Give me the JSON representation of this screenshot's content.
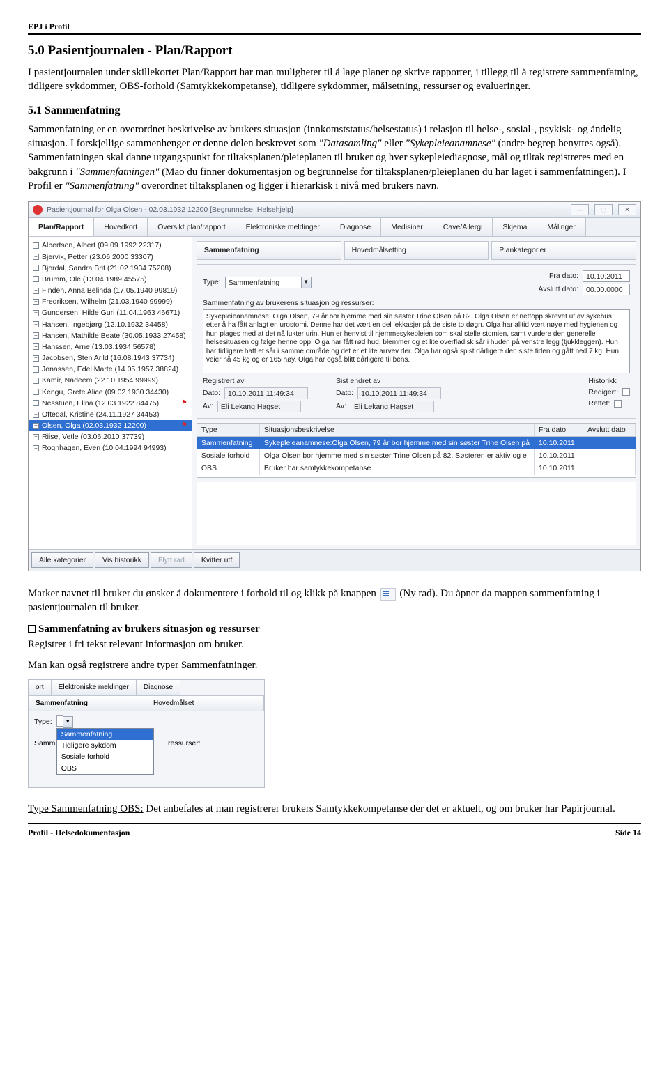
{
  "doc": {
    "header": "EPJ i Profil",
    "h2": "5.0 Pasientjournalen - Plan/Rapport",
    "p1": "I pasientjournalen under skillekortet Plan/Rapport har man muligheter til å lage planer og skrive rapporter, i tillegg til å registrere sammenfatning, tidligere sykdommer, OBS-forhold (Samtykkekompetanse), tidligere sykdommer, målsetning, ressurser og evalueringer.",
    "h3": "5.1 Sammenfatning",
    "p2a": "Sammenfatning er en overordnet beskrivelse av brukers situasjon (innkomststatus/helsestatus) i relasjon til helse-, sosial-, psykisk- og åndelig situasjon. I forskjellige sammenhenger er denne delen beskrevet som ",
    "p2b": "\"Datasamling\"",
    "p2c": " eller ",
    "p2d": "\"Sykepleieanamnese\"",
    "p2e": " (andre begrep benyttes også). Sammenfatningen skal danne utgangspunkt for tiltaksplanen/pleieplanen til bruker og hver sykepleiediagnose, mål og tiltak registreres med en bakgrunn i ",
    "p2f": "\"Sammenfatningen\"",
    "p2g": " (Mao du finner dokumentasjon og begrunnelse for tiltaksplanen/pleieplanen du har laget i sammenfatningen). I Profil er ",
    "p2h": "\"Sammenfatning\"",
    "p2i": " overordnet tiltaksplanen og ligger i hierarkisk i nivå med brukers navn.",
    "after1a": "Marker navnet til bruker du ønsker å dokumentere i forhold til og klikk på knappen ",
    "after1b": " (Ny rad). Du åpner da mappen sammenfatning i pasientjournalen til bruker.",
    "sub_heading": "Sammenfatning av brukers situasjon og ressurser",
    "sub_line": "Registrer i fri tekst relevant informasjon om bruker.",
    "after2": "Man kan også registrere andre typer Sammenfatninger.",
    "final_a": "Type Sammenfatning OBS:",
    "final_b": " Det anbefales at man registrerer brukers Samtykkekompetanse der det er aktuelt, og om bruker har Papirjournal.",
    "footer_left": "Profil - Helsedokumentasjon",
    "footer_right": "Side 14"
  },
  "app": {
    "title": "Pasientjournal for Olga Olsen - 02.03.1932 12200  [Begrunnelse: Helsehjelp]",
    "tabs": [
      "Plan/Rapport",
      "Hovedkort",
      "Oversikt plan/rapport",
      "Elektroniske meldinger",
      "Diagnose",
      "Medisiner",
      "Cave/Allergi",
      "Skjema",
      "Målinger"
    ],
    "patients": [
      {
        "t": "Albertson, Albert (09.09.1992 22317)"
      },
      {
        "t": "Bjervik, Petter (23.06.2000 33307)"
      },
      {
        "t": "Bjordal, Sandra Brit (21.02.1934 75208)"
      },
      {
        "t": "Brumm, Ole (13.04.1989 45575)"
      },
      {
        "t": "Finden, Anna Belinda (17.05.1940 99819)"
      },
      {
        "t": "Fredriksen, Wilhelm (21.03.1940 99999)"
      },
      {
        "t": "Gundersen, Hilde Guri (11.04.1963 46671)"
      },
      {
        "t": "Hansen, Ingebjørg (12.10.1932 34458)"
      },
      {
        "t": "Hansen, Mathilde Beate (30.05.1933 27458)"
      },
      {
        "t": "Hanssen, Arne (13.03.1934 56578)"
      },
      {
        "t": "Jacobsen, Sten Arild (16.08.1943 37734)"
      },
      {
        "t": "Jonassen, Edel Marte (14.05.1957 38824)"
      },
      {
        "t": "Kamir, Nadeem (22.10.1954 99999)"
      },
      {
        "t": "Kengu, Grete Alice (09.02.1930 34430)"
      },
      {
        "t": "Nesstuen, Elina (12.03.1922 84475)",
        "flag": true
      },
      {
        "t": "Oftedal, Kristine (24.11.1927 34453)"
      },
      {
        "t": "Olsen, Olga (02.03.1932 12200)",
        "selected": true,
        "flag": true
      },
      {
        "t": "Riise, Vetle (03.06.2010 37739)"
      },
      {
        "t": "Rognhagen, Even (10.04.1994 94993)"
      }
    ],
    "section_tabs": [
      "Sammenfatning",
      "Hovedmålsetting",
      "Plankategorier"
    ],
    "type_label": "Type:",
    "type_value": "Sammenfatning",
    "fra_label": "Fra dato:",
    "fra_value": "10.10.2011",
    "avslutt_label": "Avslutt dato:",
    "avslutt_value": "00.00.0000",
    "desc_label": "Sammenfatning av brukerens situasjon og ressurser:",
    "desc_text": "Sykepleieanamnese:\nOlga Olsen, 79 år bor hjemme med sin søster Trine Olsen på 82.\nOlga Olsen er nettopp skrevet ut av sykehus etter å ha fått anlagt en urostomi. Denne har det vært en del lekkasjer på de siste to døgn. Olga har alltid vært nøye med hygienen og hun plages med at det nå lukter urin. Hun er henvist til hjemmesykepleien som skal stelle stomien, samt vurdere den generelle helsesituasen og følge henne opp.\nOlga har fått rød hud, blemmer og et lite overfladisk sår i huden på venstre legg (tjukkleggen). Hun har tidligere hatt et sår i samme område og det er et lite arrvev der.\nOlga har også spist dårligere den siste tiden og gått ned 7 kg. Hun veier nå 45 kg og er 165 høy.\nOlga har også blitt dårligere til bens.",
    "reg_header": "Registrert av",
    "endret_header": "Sist endret av",
    "hist_header": "Historikk",
    "dato_label": "Dato:",
    "av_label": "Av:",
    "dato_value": "10.10.2011  11:49:34",
    "av_value": "Eli Lekang Hagset",
    "redigert_label": "Redigert:",
    "rettet_label": "Rettet:",
    "grid_heads": [
      "Type",
      "Situasjonsbeskrivelse",
      "Fra dato",
      "Avslutt dato"
    ],
    "grid_rows": [
      {
        "c1": "Sammenfatning",
        "c2": "Sykepleieanamnese:Olga Olsen, 79 år bor hjemme med sin søster Trine Olsen på",
        "c3": "10.10.2011",
        "c4": "",
        "sel": true
      },
      {
        "c1": "Sosiale forhold",
        "c2": "Olga Olsen bor hjemme med sin søster Trine Olsen på 82. Søsteren er aktiv og e",
        "c3": "10.10.2011",
        "c4": ""
      },
      {
        "c1": "OBS",
        "c2": "Bruker har samtykkekompetanse.",
        "c3": "10.10.2011",
        "c4": ""
      }
    ],
    "buttons": [
      "Alle kategorier",
      "Vis historikk",
      "Flytt rad",
      "Kvitter utf"
    ]
  },
  "mini": {
    "top_tabs": [
      "ort",
      "Elektroniske meldinger",
      "Diagnose"
    ],
    "sec_tabs": [
      "Sammenfatning",
      "Hovedmålset"
    ],
    "type_label": "Type:",
    "samm_label": "Samm",
    "ressurser": "ressurser:",
    "options": [
      "Sammenfatning",
      "Tidligere sykdom",
      "Sosiale forhold",
      "OBS"
    ]
  }
}
